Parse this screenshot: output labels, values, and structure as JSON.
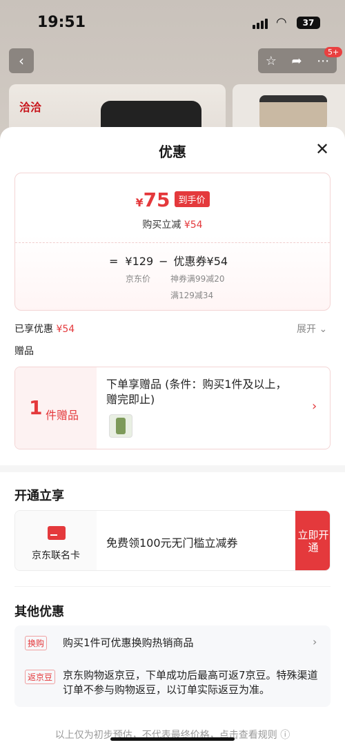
{
  "status_bar": {
    "time": "19:51",
    "battery": "37"
  },
  "nav": {
    "back_icon": "‹",
    "notification_badge": "5+"
  },
  "brand": {
    "logo_text": "洽洽"
  },
  "sheet": {
    "title": "优惠",
    "price": {
      "currency": "¥",
      "final_price": "75",
      "final_tag": "到手价",
      "reduce_label": "购买立减",
      "reduce_amount": "¥54",
      "calc_eq": "=",
      "jd_price": "¥129",
      "calc_minus": "−",
      "coupon_label": "优惠券¥54",
      "jd_price_label": "京东价",
      "coupon_line1": "神券满99减20",
      "coupon_line2": "满129减34"
    },
    "enjoyed": {
      "label": "已享优惠",
      "amount": "¥54",
      "expand": "展开"
    },
    "gifts": {
      "title": "赠品",
      "count": "1",
      "unit": "件赠品",
      "description": "下单享赠品 (条件：购买1件及以上，赠完即止)"
    },
    "membership": {
      "title": "开通立享",
      "card_name": "京东联名卡",
      "offer": "免费领100元无门槛立减券",
      "button": "立即开通"
    },
    "other": {
      "title": "其他优惠",
      "items": [
        {
          "tag": "换购",
          "text": "购买1件可优惠换购热销商品"
        },
        {
          "tag": "返京豆",
          "text": "京东购物返京豆，下单成功后最高可返7京豆。特殊渠道订单不参与购物返豆，以订单实际返豆为准。"
        }
      ]
    },
    "footer": "以上仅为初步预估，不代表最终价格，点击查看规则 ⓘ"
  }
}
